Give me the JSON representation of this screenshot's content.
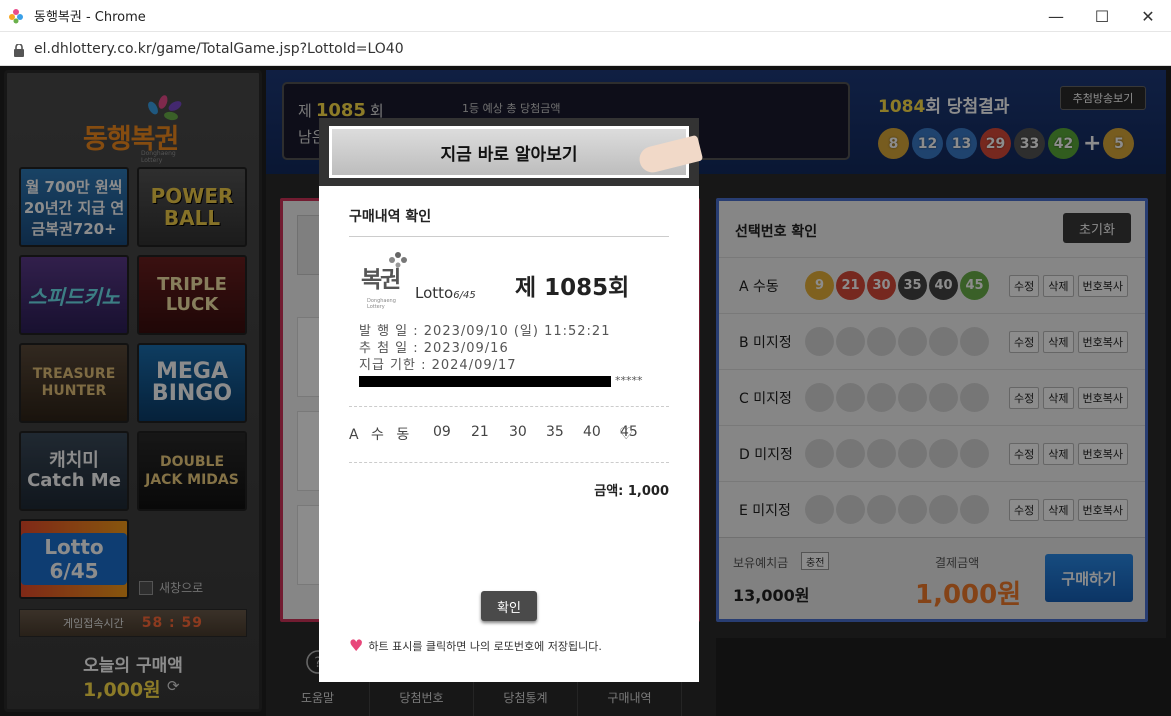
{
  "window": {
    "title": "동행복권 - Chrome",
    "url": "el.dhlottery.co.kr/game/TotalGame.jsp?LottoId=LO40",
    "minimize": "—",
    "maximize": "☐",
    "close": "✕"
  },
  "sidebar": {
    "logo_text": "동행복권",
    "logo_sub": "Donghaeng Lottery",
    "games": [
      {
        "label": "월 700만 원씩 20년간 지급 연금복권720+"
      },
      {
        "label": "POWER BALL"
      },
      {
        "label": "스피드키노"
      },
      {
        "label": "TRIPLE LUCK"
      },
      {
        "label": "TREASURE HUNTER"
      },
      {
        "label": "MEGA BINGO"
      },
      {
        "label": "캐치미 Catch Me"
      },
      {
        "label": "DOUBLE JACK MIDAS"
      },
      {
        "label": "Lotto 6/45"
      }
    ],
    "new_window_label": "새창으로",
    "timer_label": "게임접속시간",
    "timer_value": "58 : 59",
    "today_label": "오늘의 구매액",
    "today_value": "1,000원"
  },
  "topbar": {
    "round_prefix": "제",
    "round_number": "1085",
    "round_suffix": "회",
    "round_line2": "남은",
    "first_prize_label": "1등 예상 총 당첨금액",
    "result_round": "1084",
    "result_suffix": "회 당첨결과",
    "broadcast_button": "추첨방송보기",
    "winning_numbers": [
      {
        "n": "8",
        "color": "#d9a83a"
      },
      {
        "n": "12",
        "color": "#3a7ac8"
      },
      {
        "n": "13",
        "color": "#3a7ac8"
      },
      {
        "n": "29",
        "color": "#d84a3a"
      },
      {
        "n": "33",
        "color": "#555555"
      },
      {
        "n": "42",
        "color": "#5aaa3a"
      }
    ],
    "bonus_number": {
      "n": "5",
      "color": "#d9a83a"
    },
    "plus": "+"
  },
  "selection": {
    "title": "선택번호 확인",
    "reset": "초기화",
    "rows": [
      {
        "label": "A 수동",
        "balls": [
          {
            "n": "9",
            "color": "#e8b13a"
          },
          {
            "n": "21",
            "color": "#d84a3a"
          },
          {
            "n": "30",
            "color": "#d84a3a"
          },
          {
            "n": "35",
            "color": "#444444"
          },
          {
            "n": "40",
            "color": "#444444"
          },
          {
            "n": "45",
            "color": "#6ab04a"
          }
        ]
      },
      {
        "label": "B 미지정",
        "balls": []
      },
      {
        "label": "C 미지정",
        "balls": []
      },
      {
        "label": "D 미지정",
        "balls": []
      },
      {
        "label": "E 미지정",
        "balls": []
      }
    ],
    "edit": "수정",
    "delete": "삭제",
    "copy": "번호복사",
    "deposit_label": "보유예치금",
    "charge": "충전",
    "deposit_value": "13,000원",
    "pay_label": "결제금액",
    "pay_value": "1,000원",
    "buy": "구매하기"
  },
  "bottomnav": [
    {
      "label": "도움말",
      "icon": "?"
    },
    {
      "label": "당첨번호",
      "icon": "🏆"
    },
    {
      "label": "당첨통계",
      "icon": "▭"
    },
    {
      "label": "구매내역",
      "icon": "▭"
    }
  ],
  "modal": {
    "banner": "지금 바로 알아보기",
    "title": "구매내역 확인",
    "ticket_logo": "복권",
    "ticket_logo_sub": "Donghaeng Lottery",
    "lotto": "Lotto",
    "lotto_sub": "6/45",
    "round": "제 1085회",
    "issue": "발 행 일 : 2023/09/10 (일) 11:52:21",
    "draw": "추 첨 일 : 2023/09/16",
    "deadline": "지급 기한 : 2024/09/17",
    "masked_stars": "*****",
    "pick_label": "A 수 동",
    "numbers": [
      "09",
      "21",
      "30",
      "35",
      "40",
      "45"
    ],
    "heart": "♡",
    "amount": "금액: 1,000",
    "confirm": "확인",
    "note_icon": "♥",
    "note": "하트 표시를 클릭하면 나의 로또번호에 저장됩니다."
  }
}
